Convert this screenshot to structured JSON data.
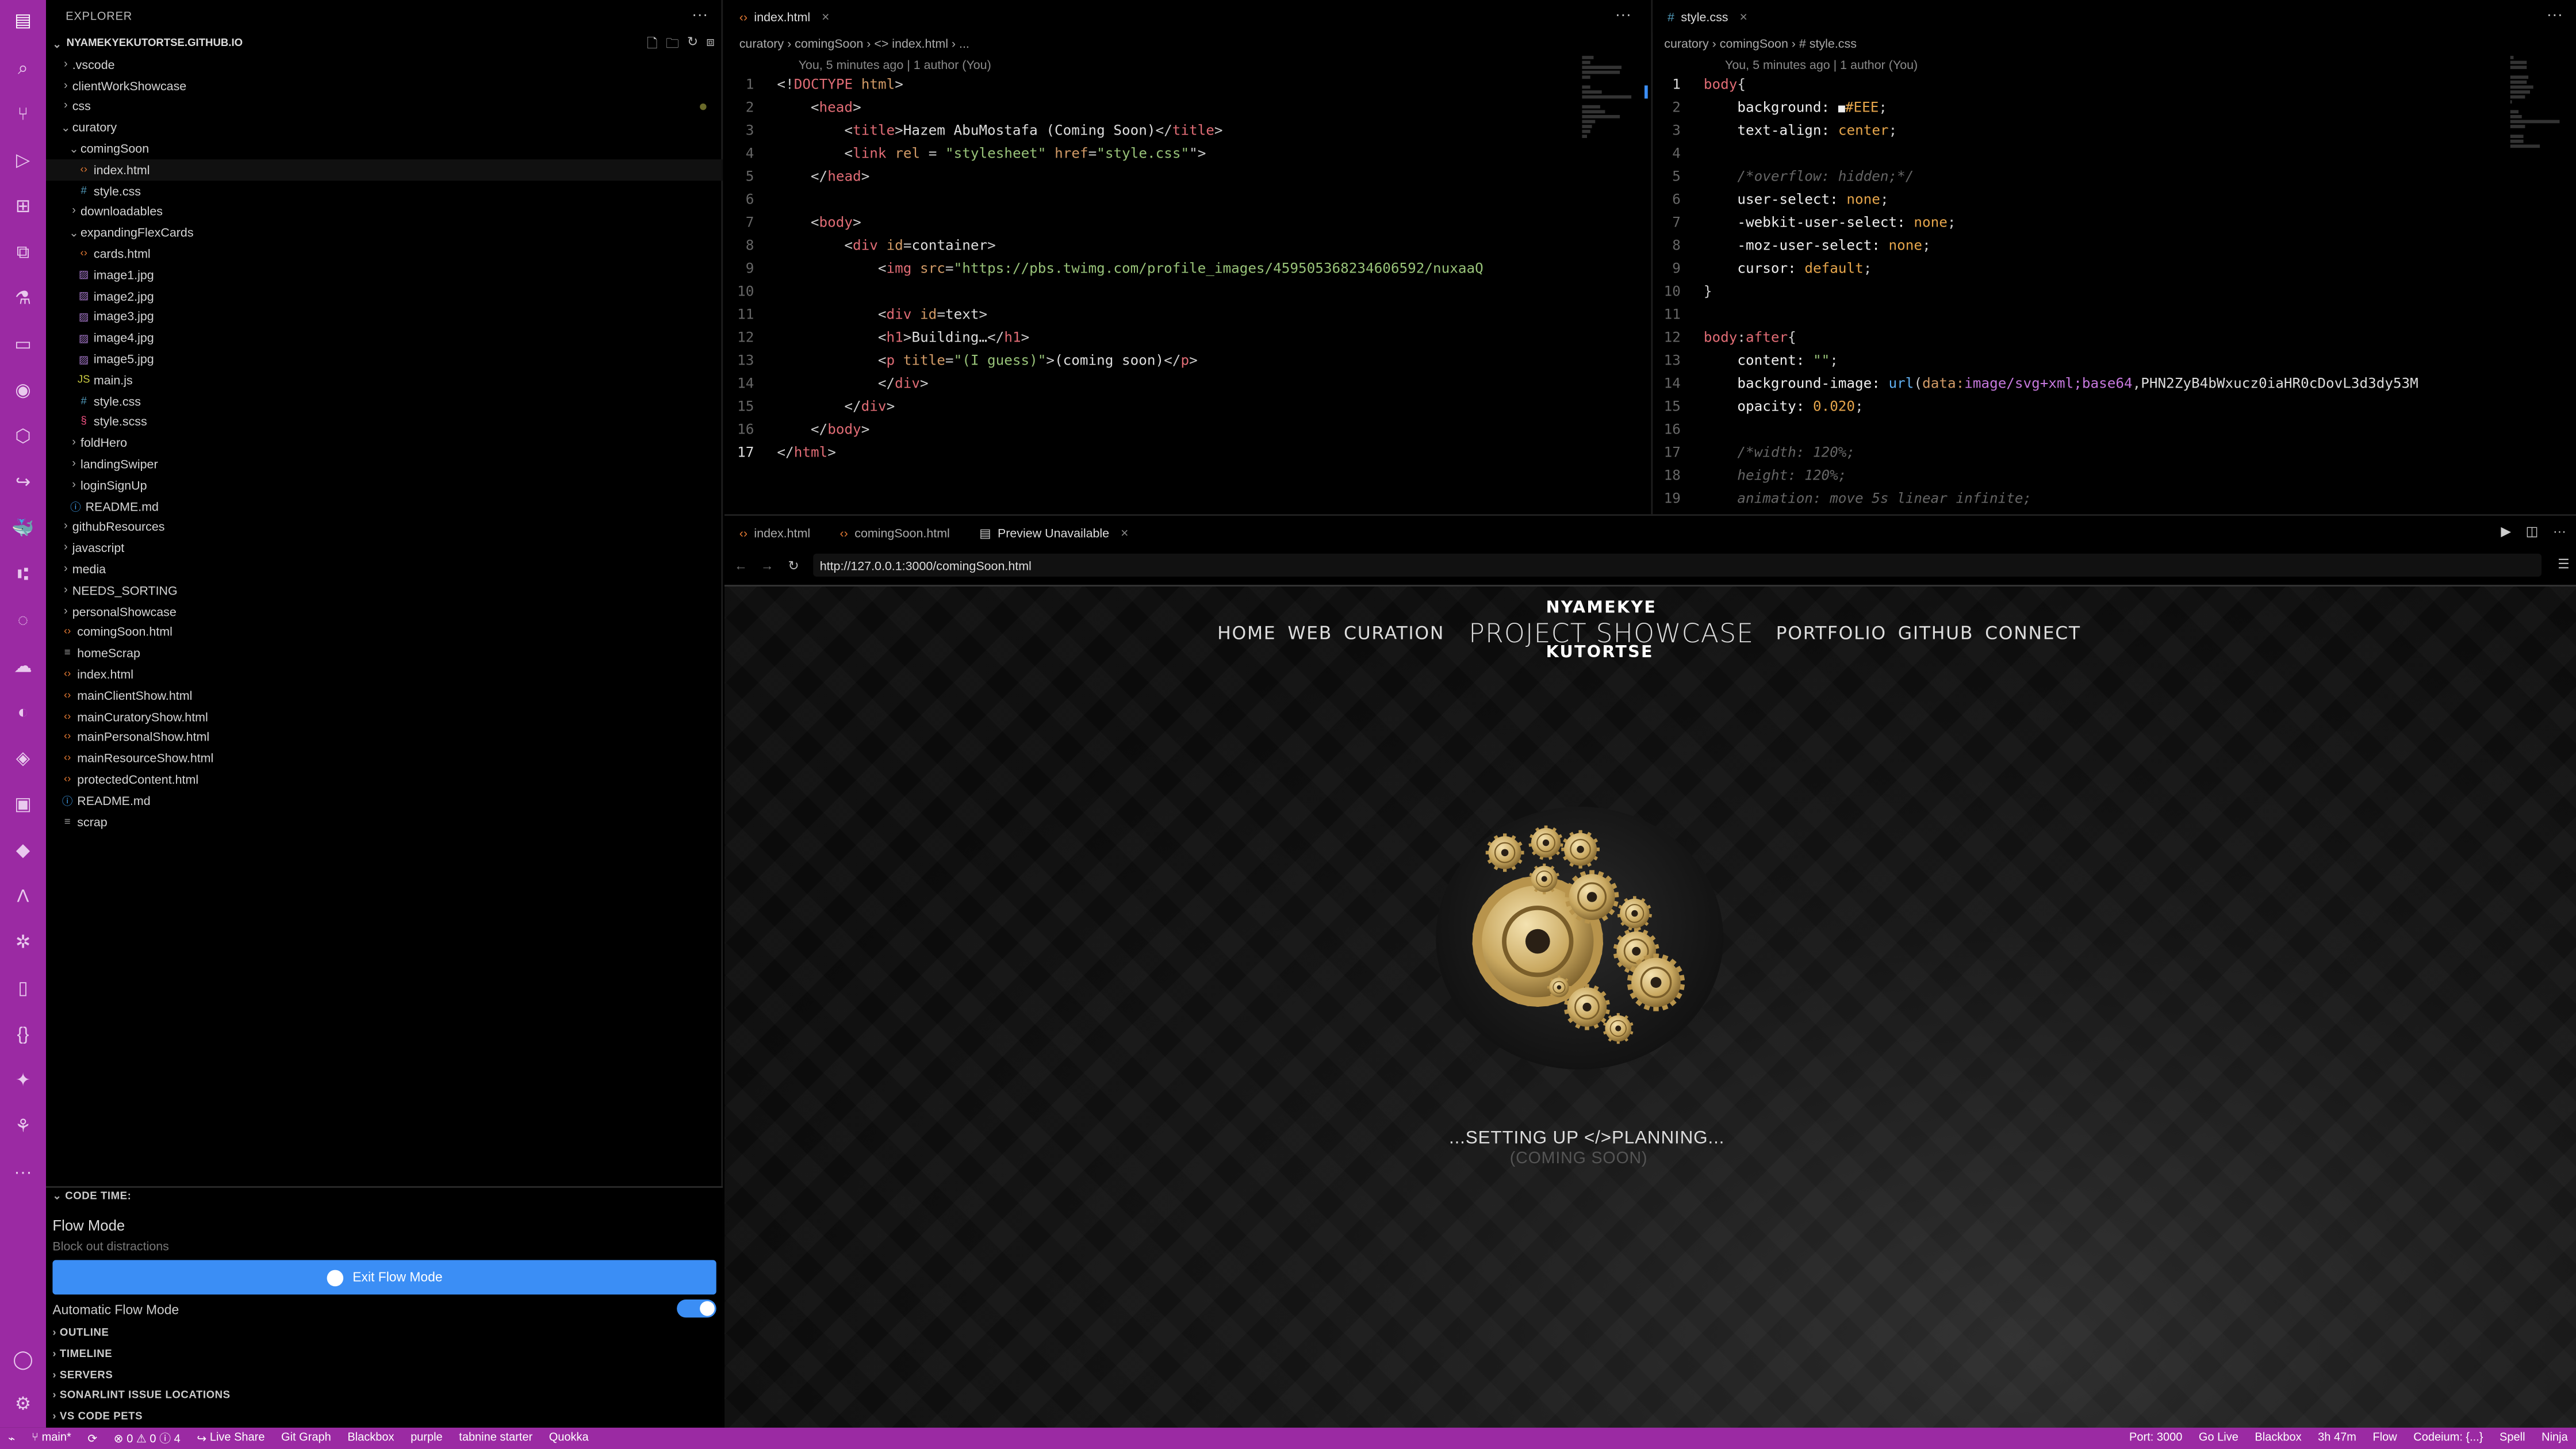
{
  "activity_bar": {
    "icons": [
      "files-icon",
      "search-icon",
      "source-control-icon",
      "run-debug-icon",
      "extensions-icon",
      "remote-explorer-icon",
      "github-icon",
      "docker-icon",
      "live-share-icon",
      "accounts-icon",
      "settings-icon"
    ]
  },
  "explorer": {
    "title": "EXPLORER",
    "root": "NYAMEKYEKUTORTSE.GITHUB.IO",
    "tree": [
      {
        "label": ".vscode",
        "type": "folder",
        "depth": 0
      },
      {
        "label": "clientWorkShowcase",
        "type": "folder",
        "depth": 0
      },
      {
        "label": "css",
        "type": "folder",
        "depth": 0,
        "modified": true
      },
      {
        "label": "curatory",
        "type": "folder-open",
        "depth": 0
      },
      {
        "label": "comingSoon",
        "type": "folder-open",
        "depth": 1
      },
      {
        "label": "index.html",
        "type": "html",
        "depth": 2
      },
      {
        "label": "style.css",
        "type": "css",
        "depth": 2
      },
      {
        "label": "downloadables",
        "type": "folder",
        "depth": 1
      },
      {
        "label": "expandingFlexCards",
        "type": "folder-open",
        "depth": 1
      },
      {
        "label": "cards.html",
        "type": "html",
        "depth": 2
      },
      {
        "label": "image1.jpg",
        "type": "img",
        "depth": 2
      },
      {
        "label": "image2.jpg",
        "type": "img",
        "depth": 2
      },
      {
        "label": "image3.jpg",
        "type": "img",
        "depth": 2
      },
      {
        "label": "image4.jpg",
        "type": "img",
        "depth": 2
      },
      {
        "label": "image5.jpg",
        "type": "img",
        "depth": 2
      },
      {
        "label": "main.js",
        "type": "js",
        "depth": 2
      },
      {
        "label": "style.css",
        "type": "css",
        "depth": 2
      },
      {
        "label": "style.scss",
        "type": "scss",
        "depth": 2
      },
      {
        "label": "foldHero",
        "type": "folder",
        "depth": 1
      },
      {
        "label": "landingSwiper",
        "type": "folder",
        "depth": 1
      },
      {
        "label": "loginSignUp",
        "type": "folder",
        "depth": 1
      },
      {
        "label": "README.md",
        "type": "md",
        "depth": 1
      },
      {
        "label": "githubResources",
        "type": "folder",
        "depth": 0
      },
      {
        "label": "javascript",
        "type": "folder",
        "depth": 0
      },
      {
        "label": "media",
        "type": "folder",
        "depth": 0
      },
      {
        "label": "NEEDS_SORTING",
        "type": "folder",
        "depth": 0
      },
      {
        "label": "personalShowcase",
        "type": "folder",
        "depth": 0
      },
      {
        "label": "comingSoon.html",
        "type": "html",
        "depth": 0
      },
      {
        "label": "homeScrap",
        "type": "txt",
        "depth": 0
      },
      {
        "label": "index.html",
        "type": "html",
        "depth": 0
      },
      {
        "label": "mainClientShow.html",
        "type": "html",
        "depth": 0
      },
      {
        "label": "mainCuratoryShow.html",
        "type": "html",
        "depth": 0
      },
      {
        "label": "mainPersonalShow.html",
        "type": "html",
        "depth": 0
      },
      {
        "label": "mainResourceShow.html",
        "type": "html",
        "depth": 0
      },
      {
        "label": "protectedContent.html",
        "type": "html",
        "depth": 0
      },
      {
        "label": "README.md",
        "type": "md",
        "depth": 0
      },
      {
        "label": "scrap",
        "type": "txt",
        "depth": 0
      }
    ]
  },
  "code_time": {
    "header": "CODE TIME:",
    "flow_title": "Flow Mode",
    "flow_subtitle": "Block out distractions",
    "exit_button": "Exit Flow Mode",
    "auto_label": "Automatic Flow Mode",
    "auto_enabled": true,
    "sections": [
      "OUTLINE",
      "TIMELINE",
      "SERVERS",
      "SONARLINT ISSUE LOCATIONS",
      "VS CODE PETS"
    ]
  },
  "editor_left": {
    "tab": "index.html",
    "breadcrumb": "curatory › comingSoon › <> index.html › ...",
    "blame": "You, 5 minutes ago | 1 author (You)",
    "current_line": 17,
    "lines": [
      [
        [
          "t-punc",
          "<!"
        ],
        [
          "t-tag",
          "DOCTYPE"
        ],
        [
          "t-punc",
          " "
        ],
        [
          "t-attr",
          "html"
        ],
        [
          "t-punc",
          ">"
        ]
      ],
      [
        [
          "t-punc",
          "    <"
        ],
        [
          "t-tag",
          "head"
        ],
        [
          "t-punc",
          ">"
        ]
      ],
      [
        [
          "t-punc",
          "        <"
        ],
        [
          "t-tag",
          "title"
        ],
        [
          "t-punc",
          ">"
        ],
        [
          "t-txt",
          "Hazem AbuMostafa (Coming Soon)"
        ],
        [
          "t-punc",
          "</"
        ],
        [
          "t-tag",
          "title"
        ],
        [
          "t-punc",
          ">"
        ]
      ],
      [
        [
          "t-punc",
          "        <"
        ],
        [
          "t-tag",
          "link"
        ],
        [
          "t-punc",
          " "
        ],
        [
          "t-attr",
          "rel"
        ],
        [
          "t-punc",
          " = "
        ],
        [
          "t-str",
          "\"stylesheet\""
        ],
        [
          "t-punc",
          " "
        ],
        [
          "t-attr",
          "href"
        ],
        [
          "t-punc",
          "="
        ],
        [
          "t-str",
          "\"style.css\""
        ],
        [
          "t-punc",
          "\">"
        ]
      ],
      [
        [
          "t-punc",
          "    </"
        ],
        [
          "t-tag",
          "head"
        ],
        [
          "t-punc",
          ">"
        ]
      ],
      [
        [
          "t-punc",
          ""
        ]
      ],
      [
        [
          "t-punc",
          "    <"
        ],
        [
          "t-tag",
          "body"
        ],
        [
          "t-punc",
          ">"
        ]
      ],
      [
        [
          "t-punc",
          "        <"
        ],
        [
          "t-tag",
          "div"
        ],
        [
          "t-punc",
          " "
        ],
        [
          "t-attr",
          "id"
        ],
        [
          "t-punc",
          "="
        ],
        [
          "t-txt",
          "container"
        ],
        [
          "t-punc",
          ">"
        ]
      ],
      [
        [
          "t-punc",
          "            <"
        ],
        [
          "t-tag",
          "img"
        ],
        [
          "t-punc",
          " "
        ],
        [
          "t-attr",
          "src"
        ],
        [
          "t-punc",
          "="
        ],
        [
          "t-str",
          "\"https://pbs.twimg.com/profile_images/459505368234606592/nuxaaQ"
        ]
      ],
      [
        [
          "t-punc",
          ""
        ]
      ],
      [
        [
          "t-punc",
          "            <"
        ],
        [
          "t-tag",
          "div"
        ],
        [
          "t-punc",
          " "
        ],
        [
          "t-attr",
          "id"
        ],
        [
          "t-punc",
          "="
        ],
        [
          "t-txt",
          "text"
        ],
        [
          "t-punc",
          ">"
        ]
      ],
      [
        [
          "t-punc",
          "            <"
        ],
        [
          "t-tag",
          "h1"
        ],
        [
          "t-punc",
          ">"
        ],
        [
          "t-txt",
          "Building…"
        ],
        [
          "t-punc",
          "</"
        ],
        [
          "t-tag",
          "h1"
        ],
        [
          "t-punc",
          ">"
        ]
      ],
      [
        [
          "t-punc",
          "            <"
        ],
        [
          "t-tag",
          "p"
        ],
        [
          "t-punc",
          " "
        ],
        [
          "t-attr",
          "title"
        ],
        [
          "t-punc",
          "="
        ],
        [
          "t-str",
          "\"(I guess)\""
        ],
        [
          "t-punc",
          ">"
        ],
        [
          "t-txt",
          "(coming soon)"
        ],
        [
          "t-punc",
          "</"
        ],
        [
          "t-tag",
          "p"
        ],
        [
          "t-punc",
          ">"
        ]
      ],
      [
        [
          "t-punc",
          "            </"
        ],
        [
          "t-tag",
          "div"
        ],
        [
          "t-punc",
          ">"
        ]
      ],
      [
        [
          "t-punc",
          "        </"
        ],
        [
          "t-tag",
          "div"
        ],
        [
          "t-punc",
          ">"
        ]
      ],
      [
        [
          "t-punc",
          "    </"
        ],
        [
          "t-tag",
          "body"
        ],
        [
          "t-punc",
          ">"
        ]
      ],
      [
        [
          "t-punc",
          "</"
        ],
        [
          "t-tag",
          "html"
        ],
        [
          "t-punc",
          ">"
        ]
      ]
    ]
  },
  "editor_right": {
    "tab": "style.css",
    "breadcrumb": "curatory › comingSoon › # style.css",
    "blame": "You, 5 minutes ago | 1 author (You)",
    "current_line": 1,
    "lines": [
      [
        [
          "t-sel",
          "body"
        ],
        [
          "t-punc",
          "{"
        ]
      ],
      [
        [
          "t-prop",
          "    background: "
        ],
        [
          "t-punc",
          "■"
        ],
        [
          "t-val",
          "#EEE"
        ],
        [
          "t-punc",
          ";"
        ]
      ],
      [
        [
          "t-prop",
          "    text-align: "
        ],
        [
          "t-val",
          "center"
        ],
        [
          "t-punc",
          ";"
        ]
      ],
      [
        [
          "t-punc",
          ""
        ]
      ],
      [
        [
          "t-com",
          "    /*overflow: hidden;*/"
        ]
      ],
      [
        [
          "t-prop",
          "    user-select: "
        ],
        [
          "t-val",
          "none"
        ],
        [
          "t-punc",
          ";"
        ]
      ],
      [
        [
          "t-prop",
          "    -webkit-user-select: "
        ],
        [
          "t-val",
          "none"
        ],
        [
          "t-punc",
          ";"
        ]
      ],
      [
        [
          "t-prop",
          "    -moz-user-select: "
        ],
        [
          "t-val",
          "none"
        ],
        [
          "t-punc",
          ";"
        ]
      ],
      [
        [
          "t-prop",
          "    cursor: "
        ],
        [
          "t-val",
          "default"
        ],
        [
          "t-punc",
          ";"
        ]
      ],
      [
        [
          "t-punc",
          "}"
        ]
      ],
      [
        [
          "t-punc",
          ""
        ]
      ],
      [
        [
          "t-sel",
          "body"
        ],
        [
          "t-punc",
          ":"
        ],
        [
          "t-sel",
          "after"
        ],
        [
          "t-punc",
          "{"
        ]
      ],
      [
        [
          "t-prop",
          "    content: "
        ],
        [
          "t-str",
          "\"\""
        ],
        [
          "t-punc",
          ";"
        ]
      ],
      [
        [
          "t-prop",
          "    background-image: "
        ],
        [
          "t-fn",
          "url"
        ],
        [
          "t-punc",
          "("
        ],
        [
          "t-attr",
          "data:"
        ],
        [
          "t-kw",
          "image/svg+xml;base64"
        ],
        [
          "t-punc",
          ","
        ],
        [
          "t-txt",
          "PHN2ZyB4bWxucz0iaHR0cDovL3d3dy53M"
        ]
      ],
      [
        [
          "t-prop",
          "    opacity: "
        ],
        [
          "t-num",
          "0.020"
        ],
        [
          "t-punc",
          ";"
        ]
      ],
      [
        [
          "t-punc",
          ""
        ]
      ],
      [
        [
          "t-com",
          "    /*width: 120%;"
        ]
      ],
      [
        [
          "t-com",
          "    height: 120%;"
        ]
      ],
      [
        [
          "t-com",
          "    animation: move 5s linear infinite;"
        ]
      ]
    ]
  },
  "preview": {
    "tabs": [
      "index.html",
      "comingSoon.html",
      "Preview Unavailable"
    ],
    "url": "http://127.0.0.1:3000/comingSoon.html",
    "site": {
      "nav_left": [
        "HOME",
        "WEB",
        "CURATION"
      ],
      "brand_top": "NYAMEKYE",
      "brand_main": "PROJECT SHOWCASE",
      "brand_bottom": "KUTORTSE",
      "nav_right": [
        "PORTFOLIO",
        "GITHUB",
        "CONNECT"
      ],
      "status": "...SETTING UP </>PLANNING...",
      "substatus": "(COMING SOON)"
    }
  },
  "status_bar": {
    "left": [
      {
        "icon": "remote-icon",
        "label": ""
      },
      {
        "icon": "branch-icon",
        "label": "main*"
      },
      {
        "icon": "sync-icon",
        "label": ""
      },
      {
        "icon": "error-icon",
        "label": "0 ⚠ 0 ⓘ 4"
      },
      {
        "icon": "live-share-icon",
        "label": "Live Share"
      },
      {
        "icon": "",
        "label": "Git Graph"
      },
      {
        "icon": "",
        "label": "Blackbox"
      },
      {
        "icon": "",
        "label": "purple"
      },
      {
        "icon": "",
        "label": "tabnine starter"
      },
      {
        "icon": "",
        "label": "Quokka"
      }
    ],
    "right": [
      {
        "icon": "",
        "label": "Port: 3000"
      },
      {
        "icon": "",
        "label": "Go Live"
      },
      {
        "icon": "",
        "label": "Blackbox"
      },
      {
        "icon": "",
        "label": "3h 47m"
      },
      {
        "icon": "",
        "label": "Flow"
      },
      {
        "icon": "",
        "label": "Codeium: {...}"
      },
      {
        "icon": "",
        "label": "Spell"
      },
      {
        "icon": "",
        "label": "Ninja"
      }
    ]
  }
}
